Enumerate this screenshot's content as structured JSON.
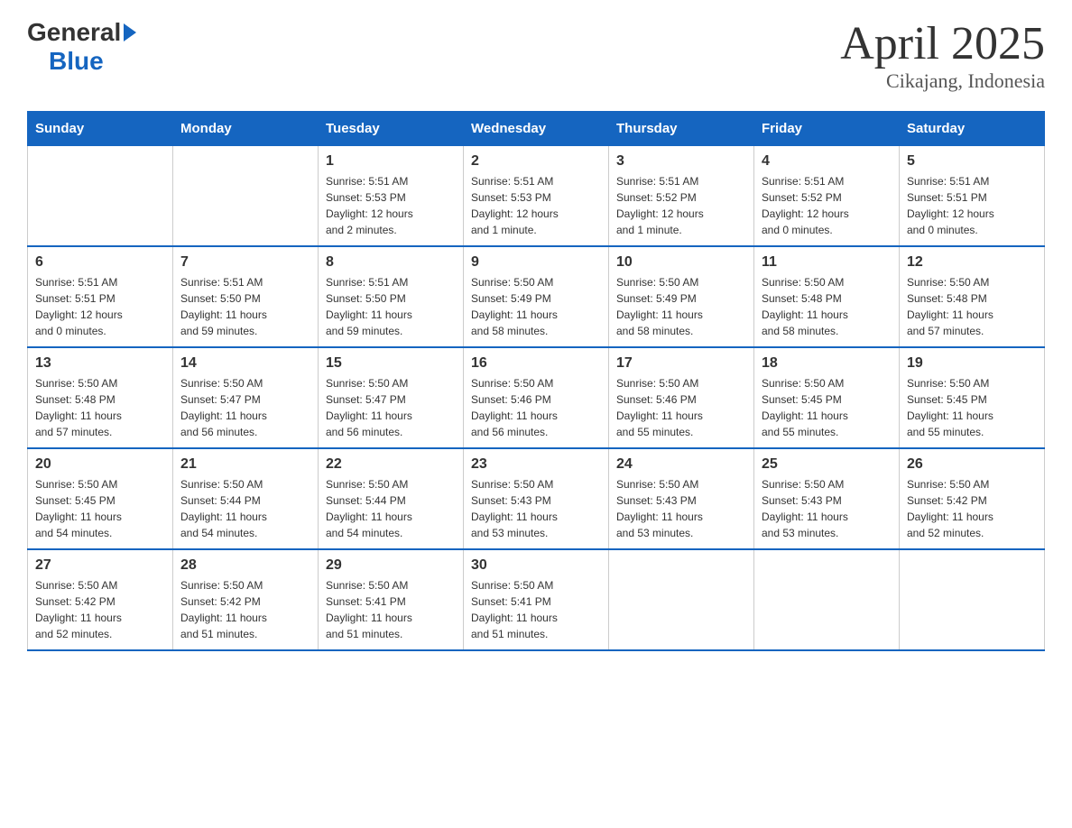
{
  "header": {
    "title": "April 2025",
    "subtitle": "Cikajang, Indonesia",
    "logo_general": "General",
    "logo_blue": "Blue"
  },
  "days_of_week": [
    "Sunday",
    "Monday",
    "Tuesday",
    "Wednesday",
    "Thursday",
    "Friday",
    "Saturday"
  ],
  "weeks": [
    [
      {
        "day": "",
        "info": ""
      },
      {
        "day": "",
        "info": ""
      },
      {
        "day": "1",
        "info": "Sunrise: 5:51 AM\nSunset: 5:53 PM\nDaylight: 12 hours\nand 2 minutes."
      },
      {
        "day": "2",
        "info": "Sunrise: 5:51 AM\nSunset: 5:53 PM\nDaylight: 12 hours\nand 1 minute."
      },
      {
        "day": "3",
        "info": "Sunrise: 5:51 AM\nSunset: 5:52 PM\nDaylight: 12 hours\nand 1 minute."
      },
      {
        "day": "4",
        "info": "Sunrise: 5:51 AM\nSunset: 5:52 PM\nDaylight: 12 hours\nand 0 minutes."
      },
      {
        "day": "5",
        "info": "Sunrise: 5:51 AM\nSunset: 5:51 PM\nDaylight: 12 hours\nand 0 minutes."
      }
    ],
    [
      {
        "day": "6",
        "info": "Sunrise: 5:51 AM\nSunset: 5:51 PM\nDaylight: 12 hours\nand 0 minutes."
      },
      {
        "day": "7",
        "info": "Sunrise: 5:51 AM\nSunset: 5:50 PM\nDaylight: 11 hours\nand 59 minutes."
      },
      {
        "day": "8",
        "info": "Sunrise: 5:51 AM\nSunset: 5:50 PM\nDaylight: 11 hours\nand 59 minutes."
      },
      {
        "day": "9",
        "info": "Sunrise: 5:50 AM\nSunset: 5:49 PM\nDaylight: 11 hours\nand 58 minutes."
      },
      {
        "day": "10",
        "info": "Sunrise: 5:50 AM\nSunset: 5:49 PM\nDaylight: 11 hours\nand 58 minutes."
      },
      {
        "day": "11",
        "info": "Sunrise: 5:50 AM\nSunset: 5:48 PM\nDaylight: 11 hours\nand 58 minutes."
      },
      {
        "day": "12",
        "info": "Sunrise: 5:50 AM\nSunset: 5:48 PM\nDaylight: 11 hours\nand 57 minutes."
      }
    ],
    [
      {
        "day": "13",
        "info": "Sunrise: 5:50 AM\nSunset: 5:48 PM\nDaylight: 11 hours\nand 57 minutes."
      },
      {
        "day": "14",
        "info": "Sunrise: 5:50 AM\nSunset: 5:47 PM\nDaylight: 11 hours\nand 56 minutes."
      },
      {
        "day": "15",
        "info": "Sunrise: 5:50 AM\nSunset: 5:47 PM\nDaylight: 11 hours\nand 56 minutes."
      },
      {
        "day": "16",
        "info": "Sunrise: 5:50 AM\nSunset: 5:46 PM\nDaylight: 11 hours\nand 56 minutes."
      },
      {
        "day": "17",
        "info": "Sunrise: 5:50 AM\nSunset: 5:46 PM\nDaylight: 11 hours\nand 55 minutes."
      },
      {
        "day": "18",
        "info": "Sunrise: 5:50 AM\nSunset: 5:45 PM\nDaylight: 11 hours\nand 55 minutes."
      },
      {
        "day": "19",
        "info": "Sunrise: 5:50 AM\nSunset: 5:45 PM\nDaylight: 11 hours\nand 55 minutes."
      }
    ],
    [
      {
        "day": "20",
        "info": "Sunrise: 5:50 AM\nSunset: 5:45 PM\nDaylight: 11 hours\nand 54 minutes."
      },
      {
        "day": "21",
        "info": "Sunrise: 5:50 AM\nSunset: 5:44 PM\nDaylight: 11 hours\nand 54 minutes."
      },
      {
        "day": "22",
        "info": "Sunrise: 5:50 AM\nSunset: 5:44 PM\nDaylight: 11 hours\nand 54 minutes."
      },
      {
        "day": "23",
        "info": "Sunrise: 5:50 AM\nSunset: 5:43 PM\nDaylight: 11 hours\nand 53 minutes."
      },
      {
        "day": "24",
        "info": "Sunrise: 5:50 AM\nSunset: 5:43 PM\nDaylight: 11 hours\nand 53 minutes."
      },
      {
        "day": "25",
        "info": "Sunrise: 5:50 AM\nSunset: 5:43 PM\nDaylight: 11 hours\nand 53 minutes."
      },
      {
        "day": "26",
        "info": "Sunrise: 5:50 AM\nSunset: 5:42 PM\nDaylight: 11 hours\nand 52 minutes."
      }
    ],
    [
      {
        "day": "27",
        "info": "Sunrise: 5:50 AM\nSunset: 5:42 PM\nDaylight: 11 hours\nand 52 minutes."
      },
      {
        "day": "28",
        "info": "Sunrise: 5:50 AM\nSunset: 5:42 PM\nDaylight: 11 hours\nand 51 minutes."
      },
      {
        "day": "29",
        "info": "Sunrise: 5:50 AM\nSunset: 5:41 PM\nDaylight: 11 hours\nand 51 minutes."
      },
      {
        "day": "30",
        "info": "Sunrise: 5:50 AM\nSunset: 5:41 PM\nDaylight: 11 hours\nand 51 minutes."
      },
      {
        "day": "",
        "info": ""
      },
      {
        "day": "",
        "info": ""
      },
      {
        "day": "",
        "info": ""
      }
    ]
  ]
}
